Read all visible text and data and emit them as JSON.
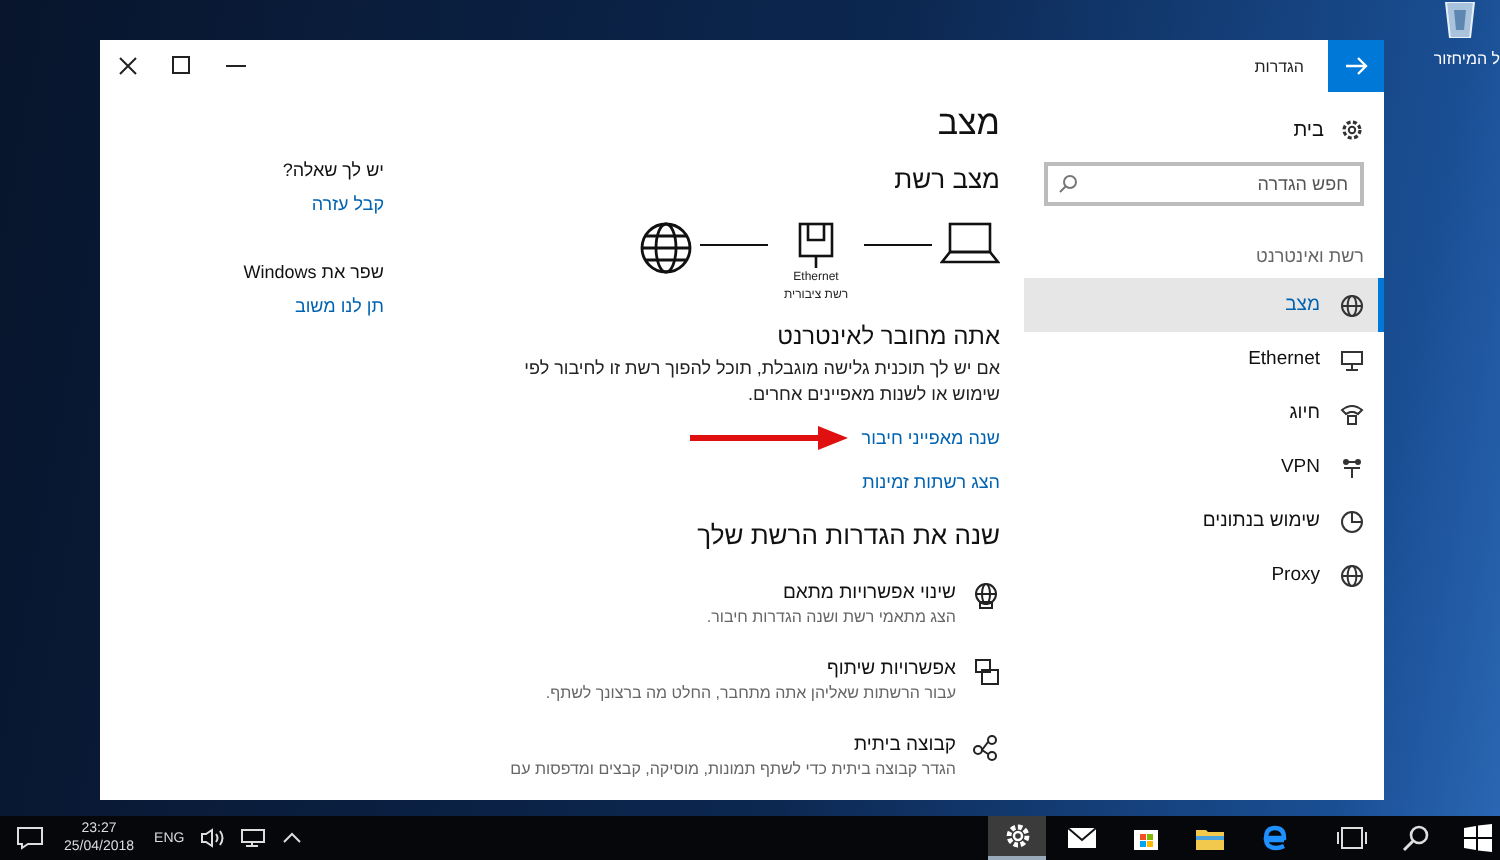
{
  "desktop": {
    "recycle_bin_label": "ל המיחזור"
  },
  "window": {
    "title": "הגדרות"
  },
  "nav": {
    "home": "בית",
    "search": {
      "placeholder": "חפש הגדרה"
    },
    "section": "רשת ואינטרנט",
    "items": [
      {
        "label": "מצב",
        "selected": true
      },
      {
        "label": "Ethernet",
        "selected": false
      },
      {
        "label": "חיוג",
        "selected": false
      },
      {
        "label": "VPN",
        "selected": false
      },
      {
        "label": "שימוש בנתונים",
        "selected": false
      },
      {
        "label": "Proxy",
        "selected": false
      }
    ]
  },
  "content": {
    "title": "מצב",
    "subtitle": "מצב רשת",
    "diagram": {
      "device_label": "Ethernet",
      "network_type": "רשת ציבורית"
    },
    "status": {
      "heading": "אתה מחובר לאינטרנט",
      "description": "אם יש לך תוכנית גלישה מוגבלת, תוכל להפוך רשת זו לחיבור לפי שימוש או לשנות מאפיינים אחרים.",
      "links": [
        "שנה מאפייני חיבור",
        "הצג רשתות זמינות"
      ]
    },
    "settings_heading": "שנה את הגדרות הרשת שלך",
    "settings": [
      {
        "title": "שינוי אפשרויות מתאם",
        "description": "הצג מתאמי רשת ושנה הגדרות חיבור."
      },
      {
        "title": "אפשרויות שיתוף",
        "description": "עבור הרשתות שאליהן אתה מתחבר, החלט מה ברצונך לשתף."
      },
      {
        "title": "קבוצה ביתית",
        "description": "הגדר קבוצה ביתית כדי לשתף תמונות, מוסיקה, קבצים ומדפסות עם"
      }
    ]
  },
  "related": [
    {
      "heading": "יש לך שאלה?",
      "link": "קבל עזרה"
    },
    {
      "heading": "שפר את Windows",
      "link": "תן לנו משוב"
    }
  ],
  "taskbar": {
    "time": "23:27",
    "date": "25/04/2018",
    "language": "ENG",
    "apps": [
      {
        "selected": true
      },
      {
        "selected": false
      },
      {
        "selected": false
      },
      {
        "selected": false
      },
      {
        "selected": false
      }
    ]
  }
}
